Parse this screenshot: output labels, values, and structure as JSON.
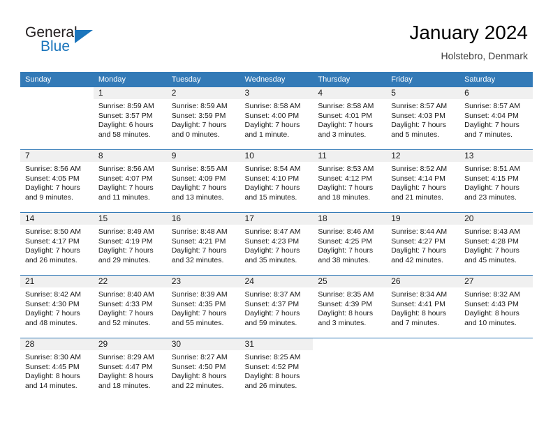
{
  "brand": {
    "name_dark": "General",
    "name_blue": "Blue",
    "accent_color": "#1b75bc"
  },
  "header": {
    "title": "January 2024",
    "subtitle": "Holstebro, Denmark"
  },
  "calendar": {
    "header_color": "#337ab7",
    "daynum_band_color": "#f0f0f0",
    "weekday_headers": [
      "Sunday",
      "Monday",
      "Tuesday",
      "Wednesday",
      "Thursday",
      "Friday",
      "Saturday"
    ],
    "weeks": [
      [
        {
          "day": "",
          "lines": []
        },
        {
          "day": "1",
          "lines": [
            "Sunrise: 8:59 AM",
            "Sunset: 3:57 PM",
            "Daylight: 6 hours",
            "and 58 minutes."
          ]
        },
        {
          "day": "2",
          "lines": [
            "Sunrise: 8:59 AM",
            "Sunset: 3:59 PM",
            "Daylight: 7 hours",
            "and 0 minutes."
          ]
        },
        {
          "day": "3",
          "lines": [
            "Sunrise: 8:58 AM",
            "Sunset: 4:00 PM",
            "Daylight: 7 hours",
            "and 1 minute."
          ]
        },
        {
          "day": "4",
          "lines": [
            "Sunrise: 8:58 AM",
            "Sunset: 4:01 PM",
            "Daylight: 7 hours",
            "and 3 minutes."
          ]
        },
        {
          "day": "5",
          "lines": [
            "Sunrise: 8:57 AM",
            "Sunset: 4:03 PM",
            "Daylight: 7 hours",
            "and 5 minutes."
          ]
        },
        {
          "day": "6",
          "lines": [
            "Sunrise: 8:57 AM",
            "Sunset: 4:04 PM",
            "Daylight: 7 hours",
            "and 7 minutes."
          ]
        }
      ],
      [
        {
          "day": "7",
          "lines": [
            "Sunrise: 8:56 AM",
            "Sunset: 4:05 PM",
            "Daylight: 7 hours",
            "and 9 minutes."
          ]
        },
        {
          "day": "8",
          "lines": [
            "Sunrise: 8:56 AM",
            "Sunset: 4:07 PM",
            "Daylight: 7 hours",
            "and 11 minutes."
          ]
        },
        {
          "day": "9",
          "lines": [
            "Sunrise: 8:55 AM",
            "Sunset: 4:09 PM",
            "Daylight: 7 hours",
            "and 13 minutes."
          ]
        },
        {
          "day": "10",
          "lines": [
            "Sunrise: 8:54 AM",
            "Sunset: 4:10 PM",
            "Daylight: 7 hours",
            "and 15 minutes."
          ]
        },
        {
          "day": "11",
          "lines": [
            "Sunrise: 8:53 AM",
            "Sunset: 4:12 PM",
            "Daylight: 7 hours",
            "and 18 minutes."
          ]
        },
        {
          "day": "12",
          "lines": [
            "Sunrise: 8:52 AM",
            "Sunset: 4:14 PM",
            "Daylight: 7 hours",
            "and 21 minutes."
          ]
        },
        {
          "day": "13",
          "lines": [
            "Sunrise: 8:51 AM",
            "Sunset: 4:15 PM",
            "Daylight: 7 hours",
            "and 23 minutes."
          ]
        }
      ],
      [
        {
          "day": "14",
          "lines": [
            "Sunrise: 8:50 AM",
            "Sunset: 4:17 PM",
            "Daylight: 7 hours",
            "and 26 minutes."
          ]
        },
        {
          "day": "15",
          "lines": [
            "Sunrise: 8:49 AM",
            "Sunset: 4:19 PM",
            "Daylight: 7 hours",
            "and 29 minutes."
          ]
        },
        {
          "day": "16",
          "lines": [
            "Sunrise: 8:48 AM",
            "Sunset: 4:21 PM",
            "Daylight: 7 hours",
            "and 32 minutes."
          ]
        },
        {
          "day": "17",
          "lines": [
            "Sunrise: 8:47 AM",
            "Sunset: 4:23 PM",
            "Daylight: 7 hours",
            "and 35 minutes."
          ]
        },
        {
          "day": "18",
          "lines": [
            "Sunrise: 8:46 AM",
            "Sunset: 4:25 PM",
            "Daylight: 7 hours",
            "and 38 minutes."
          ]
        },
        {
          "day": "19",
          "lines": [
            "Sunrise: 8:44 AM",
            "Sunset: 4:27 PM",
            "Daylight: 7 hours",
            "and 42 minutes."
          ]
        },
        {
          "day": "20",
          "lines": [
            "Sunrise: 8:43 AM",
            "Sunset: 4:28 PM",
            "Daylight: 7 hours",
            "and 45 minutes."
          ]
        }
      ],
      [
        {
          "day": "21",
          "lines": [
            "Sunrise: 8:42 AM",
            "Sunset: 4:30 PM",
            "Daylight: 7 hours",
            "and 48 minutes."
          ]
        },
        {
          "day": "22",
          "lines": [
            "Sunrise: 8:40 AM",
            "Sunset: 4:33 PM",
            "Daylight: 7 hours",
            "and 52 minutes."
          ]
        },
        {
          "day": "23",
          "lines": [
            "Sunrise: 8:39 AM",
            "Sunset: 4:35 PM",
            "Daylight: 7 hours",
            "and 55 minutes."
          ]
        },
        {
          "day": "24",
          "lines": [
            "Sunrise: 8:37 AM",
            "Sunset: 4:37 PM",
            "Daylight: 7 hours",
            "and 59 minutes."
          ]
        },
        {
          "day": "25",
          "lines": [
            "Sunrise: 8:35 AM",
            "Sunset: 4:39 PM",
            "Daylight: 8 hours",
            "and 3 minutes."
          ]
        },
        {
          "day": "26",
          "lines": [
            "Sunrise: 8:34 AM",
            "Sunset: 4:41 PM",
            "Daylight: 8 hours",
            "and 7 minutes."
          ]
        },
        {
          "day": "27",
          "lines": [
            "Sunrise: 8:32 AM",
            "Sunset: 4:43 PM",
            "Daylight: 8 hours",
            "and 10 minutes."
          ]
        }
      ],
      [
        {
          "day": "28",
          "lines": [
            "Sunrise: 8:30 AM",
            "Sunset: 4:45 PM",
            "Daylight: 8 hours",
            "and 14 minutes."
          ]
        },
        {
          "day": "29",
          "lines": [
            "Sunrise: 8:29 AM",
            "Sunset: 4:47 PM",
            "Daylight: 8 hours",
            "and 18 minutes."
          ]
        },
        {
          "day": "30",
          "lines": [
            "Sunrise: 8:27 AM",
            "Sunset: 4:50 PM",
            "Daylight: 8 hours",
            "and 22 minutes."
          ]
        },
        {
          "day": "31",
          "lines": [
            "Sunrise: 8:25 AM",
            "Sunset: 4:52 PM",
            "Daylight: 8 hours",
            "and 26 minutes."
          ]
        },
        {
          "day": "",
          "lines": []
        },
        {
          "day": "",
          "lines": []
        },
        {
          "day": "",
          "lines": []
        }
      ]
    ]
  }
}
